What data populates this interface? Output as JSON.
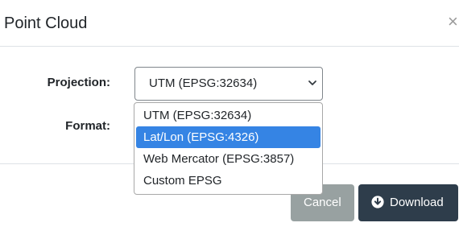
{
  "modal": {
    "title": "Point Cloud",
    "close_label": "×"
  },
  "form": {
    "projection_label": "Projection:",
    "format_label": "Format:",
    "projection_value": "UTM (EPSG:32634)",
    "projection_options": [
      "UTM (EPSG:32634)",
      "Lat/Lon (EPSG:4326)",
      "Web Mercator (EPSG:3857)",
      "Custom EPSG"
    ],
    "highlighted_option": "Lat/Lon (EPSG:4326)"
  },
  "footer": {
    "cancel_label": "Cancel",
    "download_label": "Download"
  },
  "icons": {
    "close": "close-icon",
    "caret": "chevron-down-icon",
    "download": "download-circle-icon"
  },
  "colors": {
    "highlight": "#3584e4",
    "cancel_button": "#98a1a1",
    "download_button": "#2e3d4b"
  }
}
